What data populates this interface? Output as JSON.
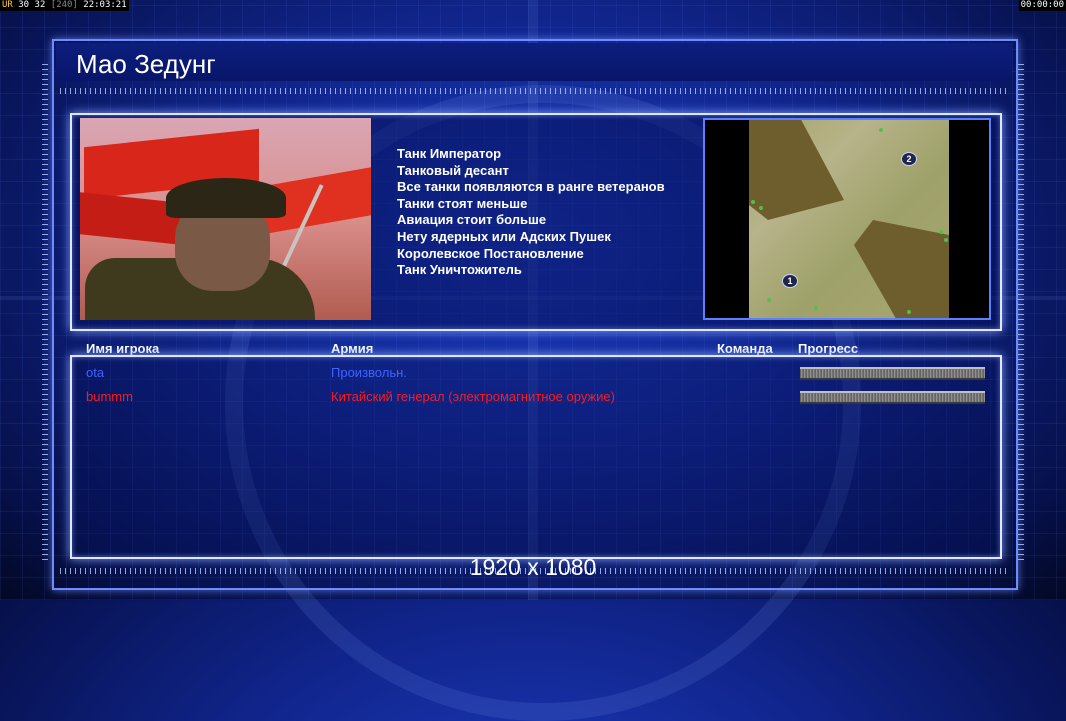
{
  "hud": {
    "left_prefix": "UR",
    "left_stats": "30 32",
    "left_extra": "[240]",
    "left_time": "22:03:21",
    "right_time": "00:00:00"
  },
  "title": "Мао Зедунг",
  "general_traits": [
    "Танк Император",
    "Танковый десант",
    "Все танки появляются в ранге ветеранов",
    "Танки стоят меньше",
    "Авиация стоит больше",
    "Нету ядерных или Адских Пушек",
    "Королевское Постановление",
    "Танк Уничтожитель"
  ],
  "minimap": {
    "start_positions": [
      "1",
      "2"
    ]
  },
  "columns": {
    "player_name": "Имя игрока",
    "army": "Армия",
    "team": "Команда",
    "progress": "Прогресс"
  },
  "players": [
    {
      "name": "ota",
      "army": "Произвольн.",
      "color": "#3f63ff",
      "progress_percent": 100
    },
    {
      "name": "bummm",
      "army": "Китайский генерал (электромагнитное оружие)",
      "color": "#ff1a1a",
      "progress_percent": 100
    }
  ],
  "resolution_text": "1920 x 1080",
  "colors": {
    "frame": "#6d8cff",
    "panel_border": "#dfe6ff",
    "background": "#10248a"
  }
}
